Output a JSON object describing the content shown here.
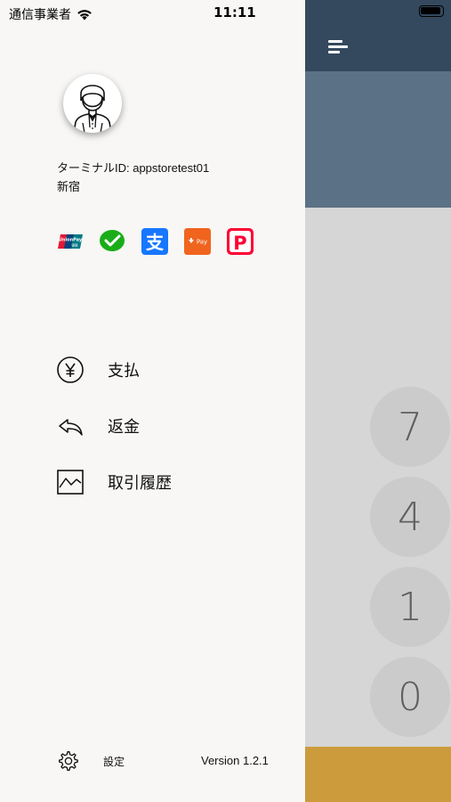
{
  "status_bar": {
    "carrier": "通信事業者",
    "time": "11:11"
  },
  "profile": {
    "terminal_id": "ターミナルID: appstoretest01",
    "store": "新宿"
  },
  "payment_methods": [
    {
      "icon": "unionpay-icon",
      "text": "UnionPay",
      "subtext": "银联"
    },
    {
      "icon": "wechat-pay-icon"
    },
    {
      "icon": "alipay-icon",
      "text": "支"
    },
    {
      "icon": "au-pay-icon",
      "text": "Pay"
    },
    {
      "icon": "paypay-icon",
      "text": "P"
    }
  ],
  "menu": [
    {
      "label": "支払",
      "icon": "yen-circle-icon"
    },
    {
      "label": "返金",
      "icon": "reply-arrow-icon"
    },
    {
      "label": "取引履歴",
      "icon": "chart-history-icon"
    }
  ],
  "footer": {
    "settings_label": "設定",
    "version": "Version 1.2.1"
  },
  "keypad": {
    "keys": [
      "7",
      "4",
      "1",
      "0"
    ]
  },
  "colors": {
    "drawer_bg": "#f8f7f5",
    "header": "#34495e",
    "band": "#5b7186",
    "keypad_bg": "#d6d6d6",
    "bottom_bar": "#cc9b3c"
  }
}
